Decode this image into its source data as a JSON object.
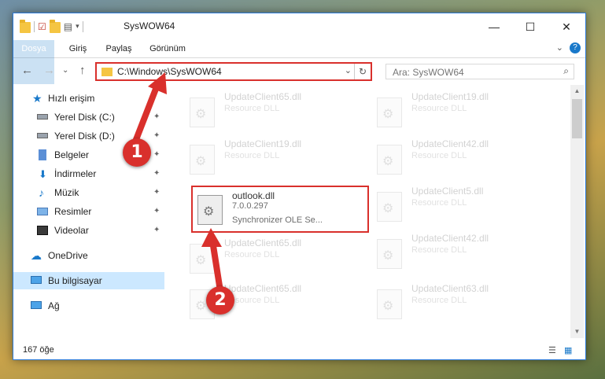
{
  "window": {
    "title": "SysWOW64",
    "controls": {
      "minimize": "—",
      "maximize": "☐",
      "close": "✕"
    }
  },
  "ribbon": {
    "tabs": [
      "Dosya",
      "Giriş",
      "Paylaş",
      "Görünüm"
    ],
    "expand": "⌄",
    "help": "?"
  },
  "nav": {
    "back": "←",
    "forward": "→",
    "recent": "⌄",
    "up": "↑",
    "address": "C:\\Windows\\SysWOW64",
    "address_dropdown": "⌄",
    "refresh": "↻",
    "search_placeholder": "Ara: SysWOW64",
    "search_icon": "⌕"
  },
  "sidebar": {
    "items": [
      {
        "label": "Hızlı erişim",
        "icon": "star-icon",
        "pinned": false
      },
      {
        "label": "Yerel Disk (C:)",
        "icon": "drive-icon",
        "pinned": true
      },
      {
        "label": "Yerel Disk (D:)",
        "icon": "drive-icon",
        "pinned": true
      },
      {
        "label": "Belgeler",
        "icon": "document-icon",
        "pinned": true
      },
      {
        "label": "İndirmeler",
        "icon": "download-icon",
        "pinned": true
      },
      {
        "label": "Müzik",
        "icon": "music-icon",
        "pinned": true
      },
      {
        "label": "Resimler",
        "icon": "pictures-icon",
        "pinned": true
      },
      {
        "label": "Videolar",
        "icon": "video-icon",
        "pinned": true
      },
      {
        "label": "OneDrive",
        "icon": "cloud-icon",
        "pinned": false
      },
      {
        "label": "Bu bilgisayar",
        "icon": "computer-icon",
        "pinned": false,
        "selected": true
      },
      {
        "label": "Ağ",
        "icon": "network-icon",
        "pinned": false
      }
    ],
    "pin_glyph": "📌"
  },
  "files": [
    {
      "name": "UpdateClient65.dll",
      "desc": "Resource DLL"
    },
    {
      "name": "UpdateClient19.dll",
      "desc": "Resource DLL"
    },
    {
      "name": "UpdateClient19.dll",
      "desc": "Resource DLL"
    },
    {
      "name": "UpdateClient42.dll",
      "desc": "Resource DLL"
    },
    {
      "name": "outlook.dll",
      "version": "7.0.0.297",
      "desc": "Synchronizer OLE Se...",
      "highlighted": true
    },
    {
      "name": "UpdateClient5.dll",
      "desc": "Resource DLL"
    },
    {
      "name": "UpdateClient65.dll",
      "desc": "Resource DLL"
    },
    {
      "name": "UpdateClient42.dll",
      "desc": "Resource DLL"
    },
    {
      "name": "UpdateClient65.dll",
      "desc": "Resource DLL"
    },
    {
      "name": "UpdateClient63.dll",
      "desc": "Resource DLL"
    },
    {
      "name": "UpdateClient42.dll",
      "desc": "Resource DLL"
    },
    {
      "name": "UpdateClient63.dll",
      "desc": "Resource DLL"
    }
  ],
  "status": {
    "count": "167 öğe"
  },
  "callouts": [
    "1",
    "2"
  ],
  "colors": {
    "accent": "#1979ca",
    "highlight": "#d9302c",
    "selection": "#cce8ff"
  }
}
